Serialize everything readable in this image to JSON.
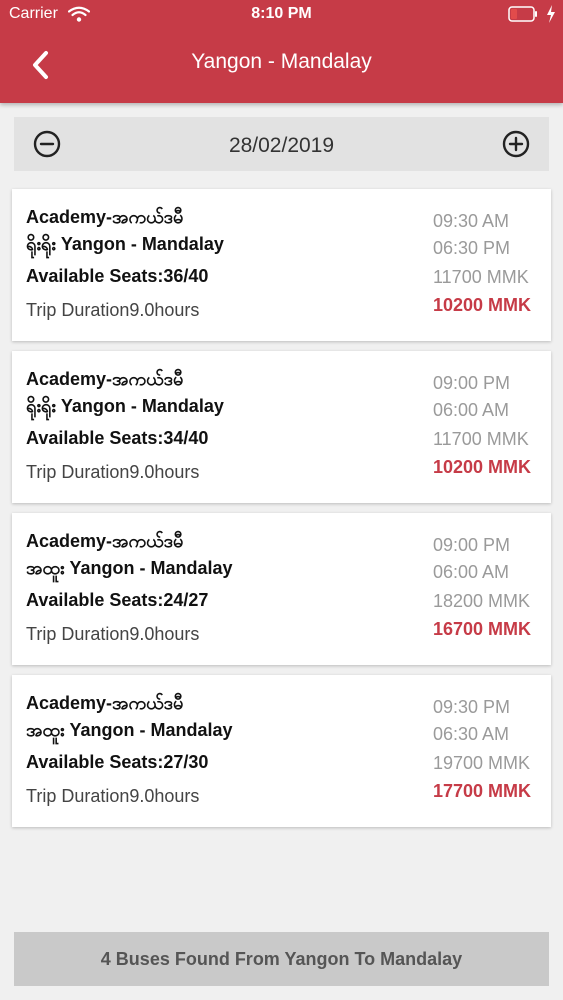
{
  "status_bar": {
    "carrier": "Carrier",
    "time": "8:10 PM"
  },
  "header": {
    "title": "Yangon - Mandalay",
    "background_color": "#c63b47"
  },
  "date_bar": {
    "date": "28/02/2019"
  },
  "trips": [
    {
      "operator": "Academy-အကယ်ဒမီ",
      "route": "ရိုးရိုး Yangon - Mandalay",
      "seats": "Available Seats:36/40",
      "duration": "Trip Duration9.0hours",
      "departure": "09:30 AM",
      "arrival": "06:30 PM",
      "original_price": "11700 MMK",
      "discount_price": "10200 MMK"
    },
    {
      "operator": "Academy-အကယ်ဒမီ",
      "route": "ရိုးရိုး Yangon - Mandalay",
      "seats": "Available Seats:34/40",
      "duration": "Trip Duration9.0hours",
      "departure": "09:00 PM",
      "arrival": "06:00 AM",
      "original_price": "11700 MMK",
      "discount_price": "10200 MMK"
    },
    {
      "operator": "Academy-အကယ်ဒမီ",
      "route": "အထူး Yangon - Mandalay",
      "seats": "Available Seats:24/27",
      "duration": "Trip Duration9.0hours",
      "departure": "09:00 PM",
      "arrival": "06:00 AM",
      "original_price": "18200 MMK",
      "discount_price": "16700 MMK"
    },
    {
      "operator": "Academy-အကယ်ဒမီ",
      "route": "အထူး Yangon - Mandalay",
      "seats": "Available Seats:27/30",
      "duration": "Trip Duration9.0hours",
      "departure": "09:30 PM",
      "arrival": "06:30 AM",
      "original_price": "19700 MMK",
      "discount_price": "17700 MMK"
    }
  ],
  "footer": {
    "summary": "4 Buses Found From Yangon To Mandalay"
  },
  "icons": {
    "back": "chevron-left-icon",
    "prev_date": "minus-circle-icon",
    "next_date": "plus-circle-icon",
    "wifi": "wifi-icon",
    "battery": "battery-icon",
    "charging": "charging-bolt-icon"
  }
}
